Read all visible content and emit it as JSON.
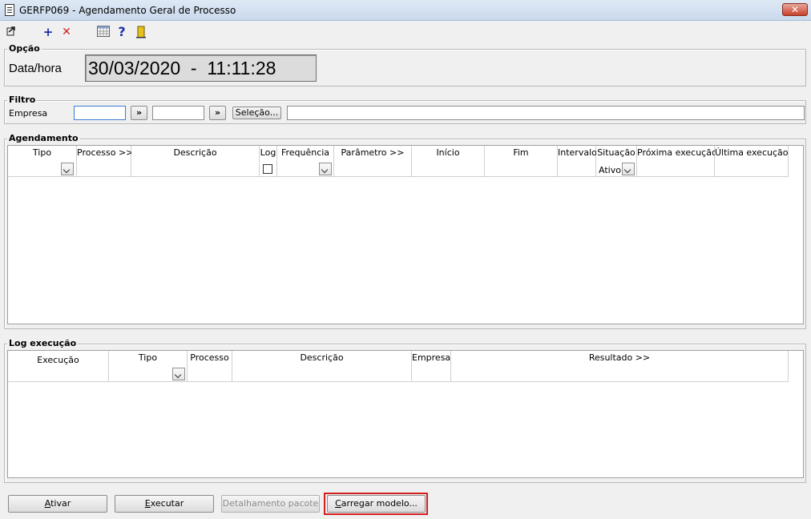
{
  "window": {
    "title": "GERFP069 - Agendamento Geral de Processo",
    "close": "✕"
  },
  "toolbar": {
    "add": "+",
    "delete": "✕",
    "help": "?"
  },
  "opcao": {
    "legend": "Opção",
    "datahora_label": "Data/hora",
    "datahora_value": "30/03/2020  -  11:11:28"
  },
  "filtro": {
    "legend": "Filtro",
    "empresa_label": "Empresa",
    "lookup1": "»",
    "lookup2": "»",
    "selecao_button": "Seleção..."
  },
  "agendamento": {
    "legend": "Agendamento",
    "columns": {
      "tipo": "Tipo",
      "processo": "Processo >>",
      "descricao": "Descrição",
      "log": "Log",
      "frequencia": "Frequência",
      "parametro": "Parâmetro >>",
      "inicio": "Início",
      "fim": "Fim",
      "intervalo": "Intervalo",
      "situacao": "Situação",
      "proxima": "Próxima execução",
      "ultima": "Última execução"
    },
    "situacao_filter": "Ativo"
  },
  "log": {
    "legend": "Log execução",
    "columns": {
      "execucao": "Execução",
      "tipo": "Tipo",
      "processo": "Processo",
      "descricao": "Descrição",
      "empresa": "Empresa",
      "resultado": "Resultado >>"
    }
  },
  "buttons": {
    "ativar_u": "A",
    "ativar_rest": "tivar",
    "executar_u": "E",
    "executar_rest": "xecutar",
    "detalhamento": "Detalhamento pacote",
    "carregar_u": "C",
    "carregar_rest": "arregar modelo..."
  },
  "colors": {
    "highlight": "#d21f1f",
    "disabled_text": "#8c8c8c"
  }
}
